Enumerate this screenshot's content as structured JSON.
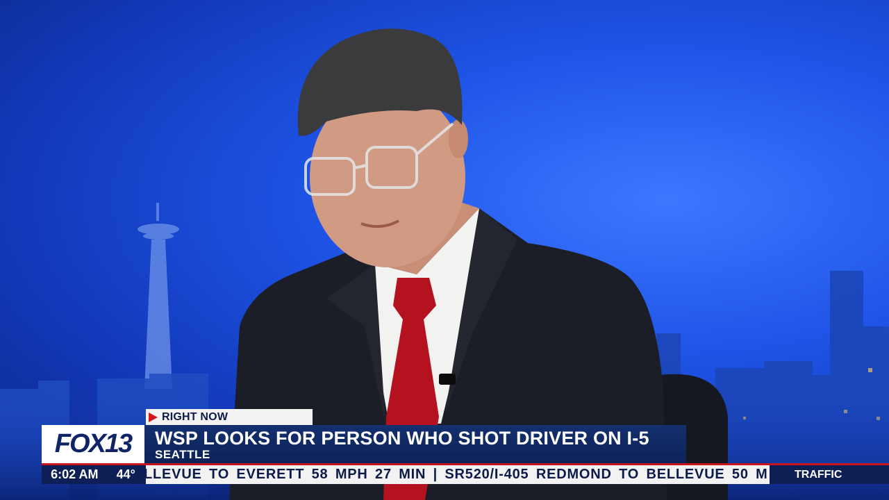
{
  "lower_third": {
    "tag": "RIGHT NOW",
    "logo": "FOX13",
    "headline": "WSP LOOKS FOR PERSON WHO SHOT DRIVER ON I-5",
    "location": "SEATTLE"
  },
  "ticker": {
    "time": "6:02 AM",
    "temperature": "44°",
    "crawl": "LLEVUE TO EVERETT 58 MPH 27 MIN | SR520/I-405 REDMOND TO BELLEVUE 50 M",
    "segment": "TRAFFIC"
  },
  "colors": {
    "backdrop_blue": "#1f55e8",
    "navy": "#0d1f55",
    "accent_red": "#c8141c"
  },
  "icons": {
    "tag_marker": "play-triangle-icon"
  }
}
